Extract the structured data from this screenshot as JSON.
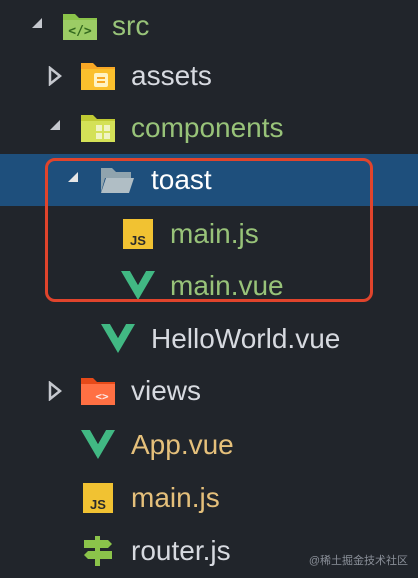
{
  "tree": {
    "src": {
      "label": "src",
      "expanded": true,
      "color": "#98c379"
    },
    "assets": {
      "label": "assets",
      "expanded": false,
      "color": "#d7dae0"
    },
    "components": {
      "label": "components",
      "expanded": true,
      "color": "#98c379"
    },
    "toast": {
      "label": "toast",
      "expanded": true,
      "color": "#ffffff",
      "selected": true
    },
    "toast_main_js": {
      "label": "main.js",
      "color": "#98c379",
      "icon": "js-file-icon"
    },
    "toast_main_vue": {
      "label": "main.vue",
      "color": "#98c379",
      "icon": "vue-file-icon"
    },
    "hello_world": {
      "label": "HelloWorld.vue",
      "color": "#d7dae0",
      "icon": "vue-file-icon"
    },
    "views": {
      "label": "views",
      "expanded": false,
      "color": "#d7dae0"
    },
    "app_vue": {
      "label": "App.vue",
      "color": "#e5c07b",
      "icon": "vue-file-icon"
    },
    "main_js": {
      "label": "main.js",
      "color": "#e5c07b",
      "icon": "js-file-icon"
    },
    "router_js": {
      "label": "router.js",
      "color": "#d7dae0",
      "icon": "router-icon"
    }
  },
  "watermark": "@稀土掘金技术社区",
  "colors": {
    "selection": "#1e4f7c",
    "highlight_border": "#e0442c",
    "vue_green": "#41b883",
    "js_yellow": "#f1c232"
  }
}
